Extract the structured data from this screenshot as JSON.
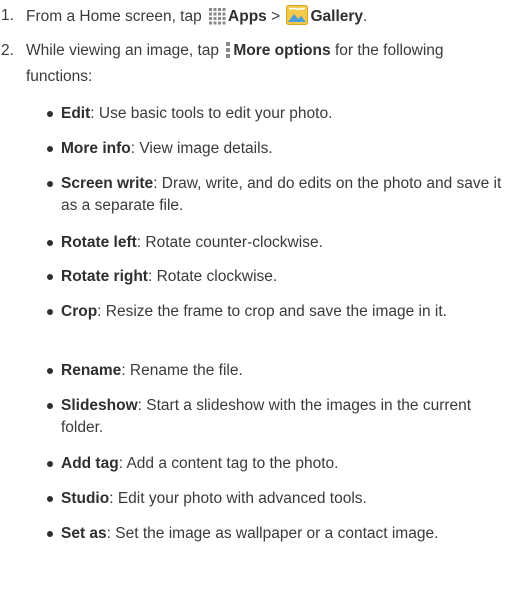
{
  "steps": [
    {
      "num": "1.",
      "prefix": "From a Home screen, tap",
      "apps_label": "Apps",
      "separator": ">",
      "gallery_label": "Gallery",
      "suffix": "."
    },
    {
      "num": "2.",
      "prefix": "While viewing an image, tap",
      "more_label": "More options",
      "suffix": "for the following functions:"
    }
  ],
  "functions": [
    {
      "term": "Edit",
      "desc": ": Use basic tools to edit your photo."
    },
    {
      "term": "More info",
      "desc": ": View image details."
    },
    {
      "term": "Screen write",
      "desc": ": Draw, write, and do edits on the photo and save it as a separate file."
    },
    {
      "term": "Rotate left",
      "desc": ": Rotate counter-clockwise."
    },
    {
      "term": "Rotate right",
      "desc": ": Rotate clockwise."
    },
    {
      "term": "Crop",
      "desc": ": Resize the frame to crop and save the image in it."
    },
    {
      "term": "Rename",
      "desc": ": Rename the file."
    },
    {
      "term": "Slideshow",
      "desc": ": Start a slideshow with the images in the current folder."
    },
    {
      "term": "Add tag",
      "desc": ": Add a content tag to the photo."
    },
    {
      "term": "Studio",
      "desc": ": Edit your photo with advanced tools."
    },
    {
      "term": "Set as",
      "desc": ": Set the image as wallpaper or a contact image."
    }
  ],
  "icons": {
    "apps": "apps-grid-icon",
    "gallery": "gallery-icon",
    "more": "more-options-icon"
  },
  "colors": {
    "text": "#3a3a3a",
    "gallery_bg": "#f2c94c",
    "gallery_accent": "#4a9fd8"
  }
}
